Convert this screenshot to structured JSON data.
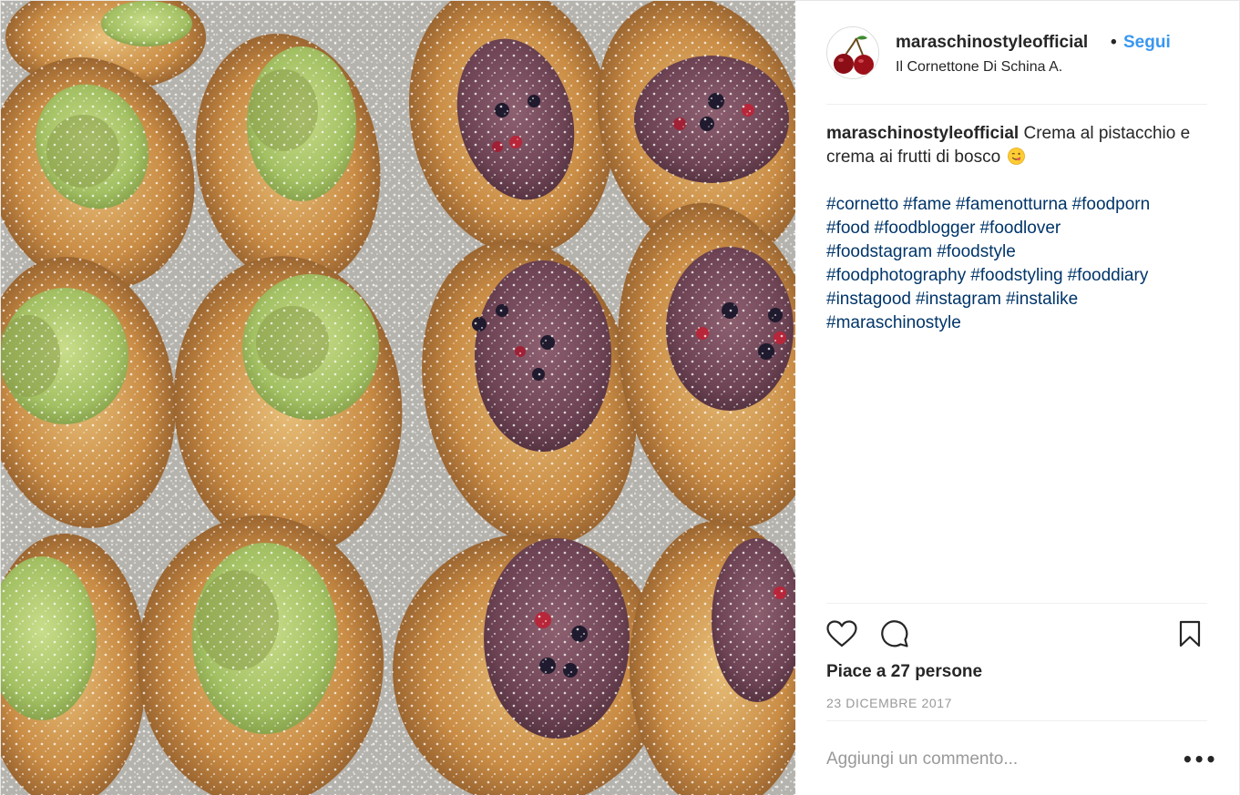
{
  "post": {
    "username": "maraschinostyleofficial",
    "follow_label": "Segui",
    "separator": "•",
    "location": "Il Cornettone Di Schina A.",
    "caption": {
      "username": "maraschinostyleofficial",
      "text": "Crema al pistacchio e crema ai frutti di bosco",
      "emoji": "yum-face-emoji",
      "hashtags": [
        "#cornetto",
        "#fame",
        "#famenotturna",
        "#foodporn",
        "#food",
        "#foodblogger",
        "#foodlover",
        "#foodstagram",
        "#foodstyle",
        "#foodphotography",
        "#foodstyling",
        "#fooddiary",
        "#instagood",
        "#instagram",
        "#instalike",
        "#maraschinostyle"
      ]
    },
    "likes_text": "Piace a 27 persone",
    "date": "23 DICEMBRE 2017",
    "comment_placeholder": "Aggiungi un commento...",
    "more_label": "•••"
  },
  "icons": {
    "like": "heart-icon",
    "comment": "comment-bubble-icon",
    "save": "bookmark-icon",
    "avatar": "cherry-logo"
  },
  "colors": {
    "follow": "#3897f0",
    "hashtag": "#003569",
    "muted": "#999999",
    "text": "#262626",
    "pistachio": "#a8c66c",
    "berry_cream": "#7a4d5c",
    "pastry": "#c98c45"
  }
}
